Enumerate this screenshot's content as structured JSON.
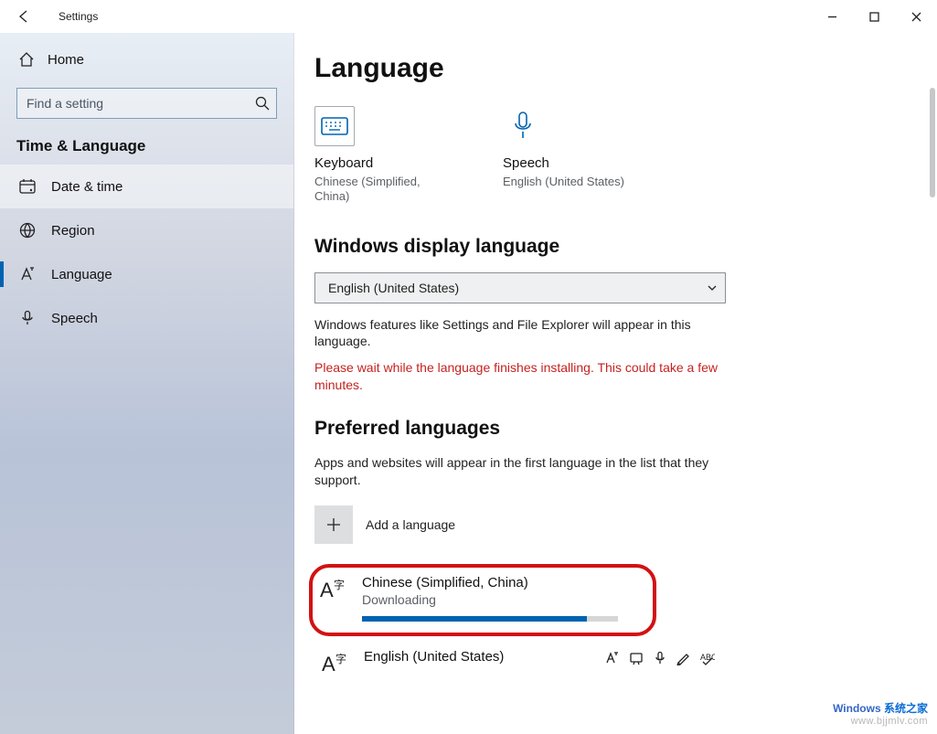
{
  "titlebar": {
    "title": "Settings"
  },
  "sidebar": {
    "home": "Home",
    "search_placeholder": "Find a setting",
    "category": "Time & Language",
    "items": [
      {
        "id": "date-time",
        "label": "Date & time",
        "selected": true,
        "active": false
      },
      {
        "id": "region",
        "label": "Region",
        "selected": false,
        "active": false
      },
      {
        "id": "language",
        "label": "Language",
        "selected": false,
        "active": true
      },
      {
        "id": "speech",
        "label": "Speech",
        "selected": false,
        "active": false
      }
    ]
  },
  "content": {
    "page_title": "Language",
    "tiles": {
      "keyboard": {
        "title": "Keyboard",
        "sub": "Chinese (Simplified, China)"
      },
      "speech": {
        "title": "Speech",
        "sub": "English (United States)"
      }
    },
    "display_lang": {
      "heading": "Windows display language",
      "selected": "English (United States)",
      "desc": "Windows features like Settings and File Explorer will appear in this language.",
      "warning": "Please wait while the language finishes installing. This could take a few minutes."
    },
    "preferred": {
      "heading": "Preferred languages",
      "desc": "Apps and websites will appear in the first language in the list that they support.",
      "add_label": "Add a language",
      "items": [
        {
          "name": "Chinese (Simplified, China)",
          "status": "Downloading",
          "progress_pct": 88,
          "highlighted": true
        },
        {
          "name": "English (United States)",
          "status": null,
          "progress_pct": null,
          "highlighted": false,
          "features": [
            "display-lang-icon",
            "tts-icon",
            "speech-rec-icon",
            "handwriting-icon",
            "spellcheck-icon"
          ]
        }
      ]
    }
  },
  "watermark": {
    "line1a": "Windows",
    "line1b": "系统之家",
    "line2": "www.bjjmlv.com"
  }
}
